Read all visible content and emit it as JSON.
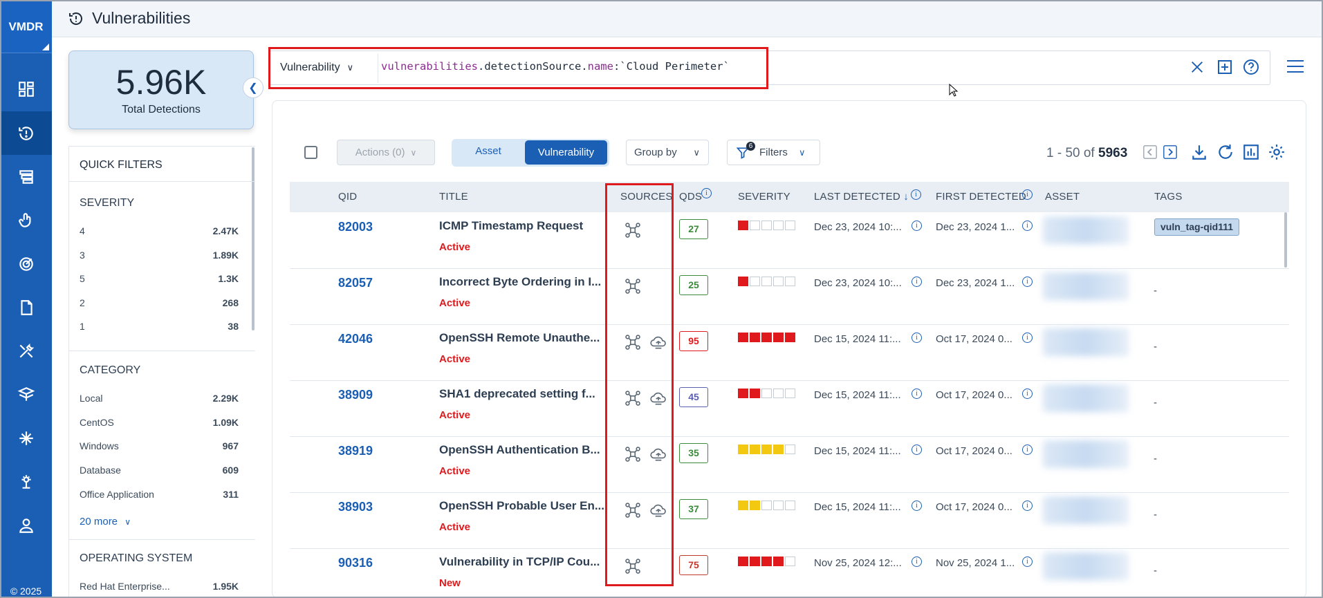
{
  "app": {
    "logo": "VMDR",
    "copyright": "© 2025",
    "page_title": "Vulnerabilities"
  },
  "nav": [
    {
      "name": "dashboard-icon"
    },
    {
      "name": "vulnerabilities-icon",
      "active": true
    },
    {
      "name": "inventory-icon"
    },
    {
      "name": "prioritization-icon"
    },
    {
      "name": "scans-icon"
    },
    {
      "name": "reports-icon"
    },
    {
      "name": "remediation-icon"
    },
    {
      "name": "assets-icon"
    },
    {
      "name": "integrations-icon"
    },
    {
      "name": "tools-icon"
    },
    {
      "name": "user-icon"
    }
  ],
  "summary": {
    "value": "5.96K",
    "label": "Total Detections"
  },
  "quick_filters": {
    "title": "QUICK FILTERS",
    "severity": {
      "label": "SEVERITY",
      "items": [
        {
          "label": "4",
          "count": "2.47K"
        },
        {
          "label": "3",
          "count": "1.89K"
        },
        {
          "label": "5",
          "count": "1.3K"
        },
        {
          "label": "2",
          "count": "268"
        },
        {
          "label": "1",
          "count": "38"
        }
      ]
    },
    "category": {
      "label": "CATEGORY",
      "items": [
        {
          "label": "Local",
          "count": "2.29K"
        },
        {
          "label": "CentOS",
          "count": "1.09K"
        },
        {
          "label": "Windows",
          "count": "967"
        },
        {
          "label": "Database",
          "count": "609"
        },
        {
          "label": "Office Application",
          "count": "311"
        }
      ]
    },
    "more": "20 more",
    "os": {
      "label": "OPERATING SYSTEM",
      "items": [
        {
          "label": "Red Hat Enterprise...",
          "count": "1.95K"
        }
      ]
    }
  },
  "search": {
    "type": "Vulnerability",
    "query_parts": [
      "vulnerabilities",
      ".detectionSource.",
      "name",
      ":`Cloud Perimeter`"
    ]
  },
  "toolbar": {
    "actions": "Actions (0)",
    "view_asset": "Asset",
    "view_vuln": "Vulnerability",
    "group_by": "Group by",
    "filters": "Filters",
    "filter_count": "6",
    "pager_range": "1 - 50 of",
    "pager_total": "5963"
  },
  "table": {
    "headers": {
      "qid": "QID",
      "title": "TITLE",
      "sources": "SOURCES",
      "qds": "QDS",
      "severity": "SEVERITY",
      "last": "LAST DETECTED",
      "first": "FIRST DETECTED",
      "asset": "ASSET",
      "tags": "TAGS"
    },
    "rows": [
      {
        "qid": "82003",
        "title": "ICMP Timestamp Request",
        "status": "Active",
        "sources": [
          "network"
        ],
        "qds": "27",
        "qds_color": "#3a8a3a",
        "sev": 1,
        "sev_color": "#e0191d",
        "last": "Dec 23, 2024 10:...",
        "first": "Dec 23, 2024 1...",
        "tag": "vuln_tag-qid111"
      },
      {
        "qid": "82057",
        "title": "Incorrect Byte Ordering in I...",
        "status": "Active",
        "sources": [
          "network"
        ],
        "qds": "25",
        "qds_color": "#3a8a3a",
        "sev": 1,
        "sev_color": "#e0191d",
        "last": "Dec 23, 2024 10:...",
        "first": "Dec 23, 2024 1...",
        "tag": "-"
      },
      {
        "qid": "42046",
        "title": "OpenSSH Remote Unauthe...",
        "status": "Active",
        "sources": [
          "network",
          "cloud"
        ],
        "qds": "95",
        "qds_color": "#e0191d",
        "sev": 5,
        "sev_color": "#e0191d",
        "last": "Dec 15, 2024 11:...",
        "first": "Oct 17, 2024 0...",
        "tag": "-"
      },
      {
        "qid": "38909",
        "title": "SHA1 deprecated setting f...",
        "status": "Active",
        "sources": [
          "network",
          "cloud"
        ],
        "qds": "45",
        "qds_color": "#5a5fb0",
        "sev": 2,
        "sev_color": "#e0191d",
        "last": "Dec 15, 2024 11:...",
        "first": "Oct 17, 2024 0...",
        "tag": "-"
      },
      {
        "qid": "38919",
        "title": "OpenSSH Authentication B...",
        "status": "Active",
        "sources": [
          "network",
          "cloud"
        ],
        "qds": "35",
        "qds_color": "#3a8a3a",
        "sev": 4,
        "sev_color": "#f2c811",
        "last": "Dec 15, 2024 11:...",
        "first": "Oct 17, 2024 0...",
        "tag": "-"
      },
      {
        "qid": "38903",
        "title": "OpenSSH Probable User En...",
        "status": "Active",
        "sources": [
          "network",
          "cloud"
        ],
        "qds": "37",
        "qds_color": "#3a8a3a",
        "sev": 2,
        "sev_color": "#f2c811",
        "last": "Dec 15, 2024 11:...",
        "first": "Oct 17, 2024 0...",
        "tag": "-"
      },
      {
        "qid": "90316",
        "title": "Vulnerability in TCP/IP Cou...",
        "status": "New",
        "sources": [
          "network"
        ],
        "qds": "75",
        "qds_color": "#c0392b",
        "sev": 4,
        "sev_color": "#e0191d",
        "last": "Nov 25, 2024 12:...",
        "first": "Nov 25, 2024 1...",
        "tag": "-"
      }
    ]
  }
}
